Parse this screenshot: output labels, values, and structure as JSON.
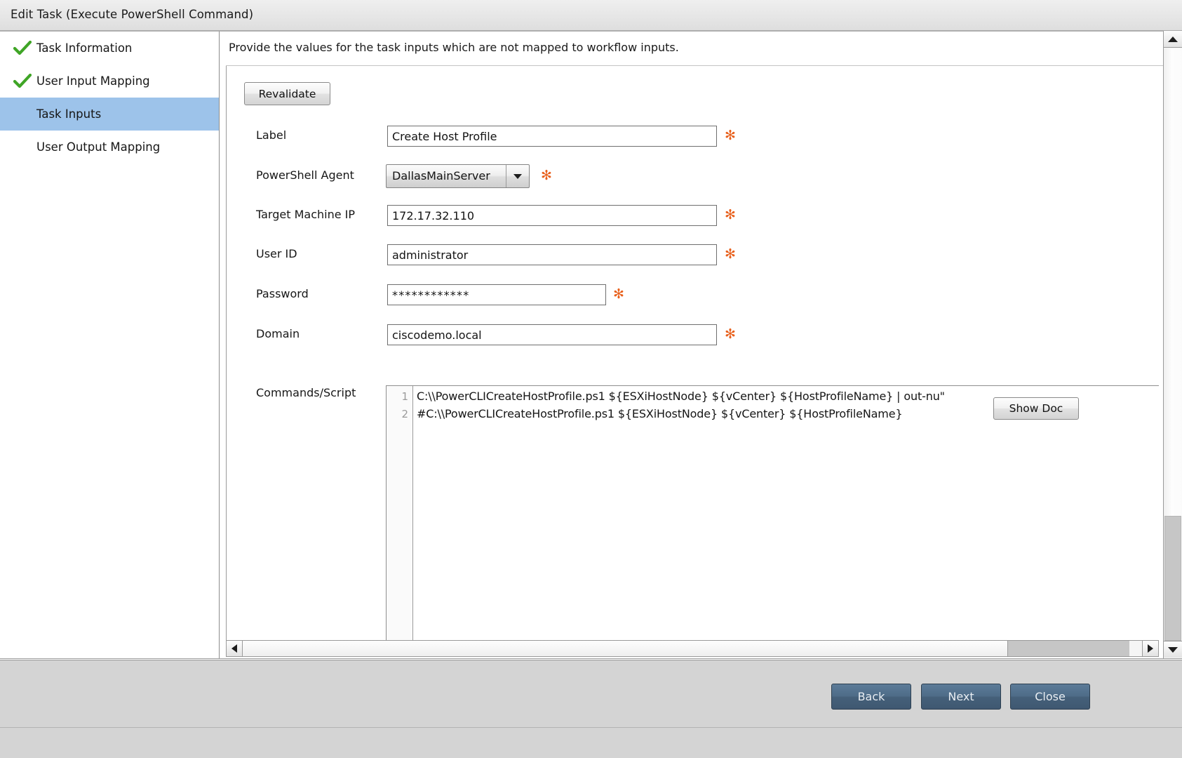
{
  "window": {
    "title": "Edit Task (Execute PowerShell Command)"
  },
  "sidebar": {
    "items": [
      {
        "label": "Task Information",
        "checked": true,
        "selected": false
      },
      {
        "label": "User Input Mapping",
        "checked": true,
        "selected": false
      },
      {
        "label": "Task Inputs",
        "checked": false,
        "selected": true
      },
      {
        "label": "User Output Mapping",
        "checked": false,
        "selected": false
      }
    ]
  },
  "content": {
    "hint": "Provide the values for the task inputs which are not mapped to workflow inputs.",
    "revalidate_label": "Revalidate",
    "show_doc_label": "Show Doc",
    "required_marker": "✻",
    "fields": [
      {
        "label": "Label",
        "value": "Create Host Profile",
        "type": "text",
        "required": true
      },
      {
        "label": "PowerShell Agent",
        "value": "DallasMainServer",
        "type": "combo",
        "required": true
      },
      {
        "label": "Target Machine IP",
        "value": "172.17.32.110",
        "type": "text",
        "required": true
      },
      {
        "label": "User ID",
        "value": "administrator",
        "type": "text",
        "required": true
      },
      {
        "label": "Password",
        "value": "************",
        "type": "password",
        "required": true
      },
      {
        "label": "Domain",
        "value": "ciscodemo.local",
        "type": "text",
        "required": true
      },
      {
        "label": "Commands/Script",
        "value": "",
        "type": "script",
        "required": false
      }
    ],
    "script": {
      "line_numbers": [
        "1",
        "2"
      ],
      "lines": [
        "C:\\\\PowerCLICreateHostProfile.ps1 ${ESXiHostNode} ${vCenter} ${HostProfileName} | out-nu\"",
        "#C:\\\\PowerCLICreateHostProfile.ps1 ${ESXiHostNode} ${vCenter} ${HostProfileName}"
      ]
    }
  },
  "footer": {
    "buttons": [
      {
        "label": "Back"
      },
      {
        "label": "Next"
      },
      {
        "label": "Close"
      }
    ]
  },
  "colors": {
    "selection_blue": "#9dc3ea",
    "required_orange": "#e8601c",
    "check_green": "#3fa526",
    "footer_button_blue": "#4e6c88",
    "chrome_gray": "#d4d4d4"
  }
}
